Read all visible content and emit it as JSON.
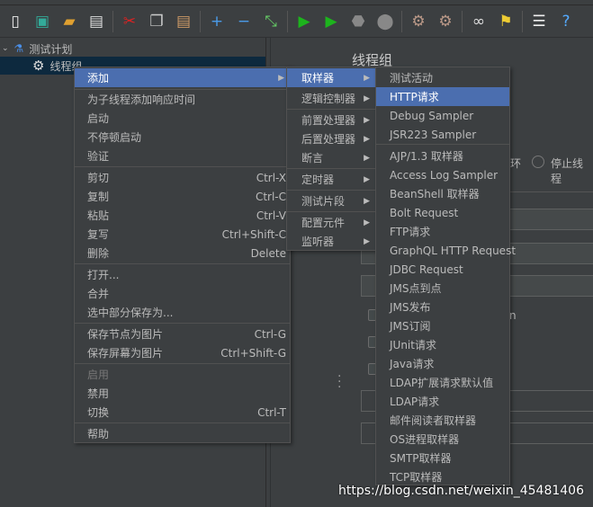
{
  "toolbar": {
    "icons": [
      "new-icon",
      "templates-icon",
      "open-icon",
      "save-icon",
      "cut-icon",
      "copy-icon",
      "paste-icon",
      "expand-icon",
      "collapse-icon",
      "toggle-icon",
      "start-icon",
      "start-no-pause-icon",
      "stop-icon",
      "shutdown-icon",
      "clear-icon",
      "clear-all-icon",
      "search-icon",
      "reset-search-icon",
      "function-helper-icon",
      "help-icon"
    ]
  },
  "tree": {
    "root": "测试计划",
    "child": "线程组"
  },
  "right_panel": {
    "title": "线程组",
    "radio_partial": "环",
    "radio_stop_thread": "停止线程",
    "label_ra": "Ra",
    "label_loop": "循",
    "label_n": "n",
    "label_duration": "持",
    "label_start": "启"
  },
  "context_menu": {
    "items": [
      {
        "label": "添加",
        "submenu": true,
        "highlighted": true
      },
      {
        "label": "为子线程添加响应时间"
      },
      {
        "label": "启动"
      },
      {
        "label": "不停顿启动"
      },
      {
        "label": "验证"
      },
      {
        "label": "剪切",
        "shortcut": "Ctrl-X"
      },
      {
        "label": "复制",
        "shortcut": "Ctrl-C"
      },
      {
        "label": "粘贴",
        "shortcut": "Ctrl-V"
      },
      {
        "label": "复写",
        "shortcut": "Ctrl+Shift-C"
      },
      {
        "label": "删除",
        "shortcut": "Delete"
      },
      {
        "label": "打开..."
      },
      {
        "label": "合并"
      },
      {
        "label": "选中部分保存为..."
      },
      {
        "label": "保存节点为图片",
        "shortcut": "Ctrl-G"
      },
      {
        "label": "保存屏幕为图片",
        "shortcut": "Ctrl+Shift-G"
      },
      {
        "label": "启用",
        "disabled": true
      },
      {
        "label": "禁用"
      },
      {
        "label": "切换",
        "shortcut": "Ctrl-T"
      },
      {
        "label": "帮助"
      }
    ]
  },
  "add_submenu": {
    "items": [
      "取样器",
      "逻辑控制器",
      "前置处理器",
      "后置处理器",
      "断言",
      "定时器",
      "测试片段",
      "配置元件",
      "监听器"
    ]
  },
  "sampler_submenu": {
    "highlighted": "HTTP请求",
    "items": [
      "测试活动",
      "HTTP请求",
      "Debug Sampler",
      "JSR223 Sampler",
      "AJP/1.3 取样器",
      "Access Log Sampler",
      "BeanShell 取样器",
      "Bolt Request",
      "FTP请求",
      "GraphQL HTTP Request",
      "JDBC Request",
      "JMS点到点",
      "JMS发布",
      "JMS订阅",
      "JUnit请求",
      "Java请求",
      "LDAP扩展请求默认值",
      "LDAP请求",
      "邮件阅读者取样器",
      "OS进程取样器",
      "SMTP取样器",
      "TCP取样器"
    ]
  },
  "watermark": "https://blog.csdn.net/weixin_45481406",
  "colors": {
    "background": "#3c3f41",
    "highlight": "#4b6eaf",
    "tree_selected": "#0d293e"
  }
}
